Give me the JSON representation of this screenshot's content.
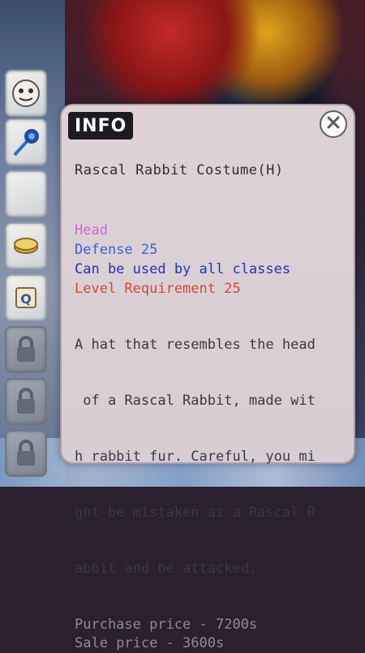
{
  "info_window": {
    "title": "INFO",
    "close_icon": "close-icon",
    "item_name": "Rascal Rabbit Costume(H)",
    "slot_type": "Head",
    "defense": "Defense 25",
    "classes": "Can be used by all classes",
    "level_requirement": "Level Requirement 25",
    "description_lines": [
      "A hat that resembles the head",
      " of a Rascal Rabbit, made wit",
      "h rabbit fur. Careful, you mi",
      "ght be mistaken as a Rascal R",
      "abbit and be attacked."
    ],
    "purchase_price": "Purchase price - 7200s",
    "sale_price": "Sale price - 3600s"
  },
  "inventory_icons": [
    "emote-face-icon",
    "mace-icon",
    "empty-slot",
    "coin-icon",
    "quest-scroll-icon",
    "lock-icon",
    "lock-icon",
    "lock-icon"
  ],
  "colors": {
    "slot_type": "#cc66dd",
    "defense": "#3b5fd8",
    "classes": "#2233bb",
    "level_requirement": "#cf4a3a",
    "description": "#3a3a40",
    "price": "#8f8c90"
  }
}
